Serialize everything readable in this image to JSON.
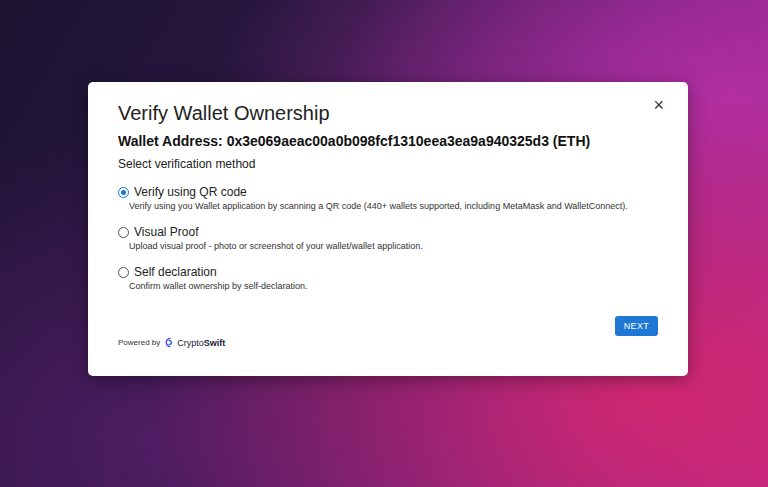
{
  "dialog": {
    "title": "Verify Wallet Ownership",
    "close": "×",
    "wallet": "Wallet Address: 0x3e069aeac00a0b098fcf1310eea3ea9a940325d3 (ETH)",
    "prompt": "Select verification method",
    "options": [
      {
        "label": "Verify using QR code",
        "description": "Verify using you Wallet application by scanning a QR code (440+ wallets supported, including MetaMask and WalletConnect).",
        "selected": true
      },
      {
        "label": "Visual Proof",
        "description": "Upload visual proof - photo or screenshot of your wallet/wallet application.",
        "selected": false
      },
      {
        "label": "Self declaration",
        "description": "Confirm wallet ownership by self-declaration.",
        "selected": false
      }
    ],
    "button": "NEXT",
    "powered_by": "Powered by",
    "brand": {
      "light": "Crypto",
      "bold": "Swift"
    }
  }
}
